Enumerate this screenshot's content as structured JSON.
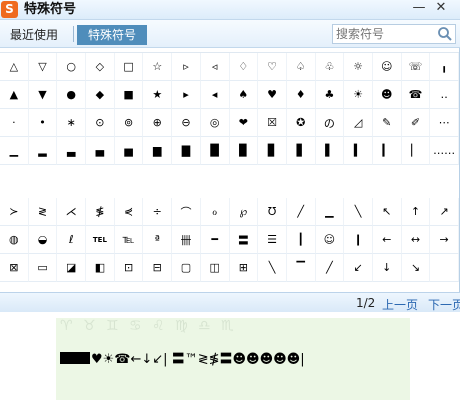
{
  "window": {
    "title": "特殊符号",
    "logo": "S",
    "minimize": "—",
    "close": "✕"
  },
  "tabs": {
    "recent": "最近使用",
    "special": "特殊符号"
  },
  "search": {
    "placeholder": "搜索符号"
  },
  "symbols_top": [
    [
      "△",
      "▽",
      "○",
      "◇",
      "□",
      "☆",
      "▹",
      "◃",
      "♢",
      "♡",
      "♤",
      "♧",
      "☼",
      "☺",
      "☏",
      "╻"
    ],
    [
      "▲",
      "▼",
      "●",
      "◆",
      "■",
      "★",
      "▸",
      "◂",
      "♠",
      "♥",
      "♦",
      "♣",
      "☀",
      "☻",
      "☎",
      "‥"
    ],
    [
      "·",
      "•",
      "∗",
      "⊙",
      "⊚",
      "⊕",
      "⊖",
      "◎",
      "❤",
      "☒",
      "✪",
      "の",
      "◿",
      "✎",
      "✐",
      "⋯"
    ],
    [
      "▁",
      "▂",
      "▃",
      "▄",
      "▅",
      "▆",
      "▇",
      "█",
      "▉",
      "▊",
      "▋",
      "▌",
      "▍",
      "▎",
      "▏",
      "……"
    ]
  ],
  "symbols_bottom": [
    [
      "≻",
      "≷",
      "⋌",
      "≸",
      "⋞",
      "÷",
      "⌒",
      "ℴ",
      "℘",
      "℧",
      "╱",
      "▁",
      "╲",
      "↖",
      "↑",
      "↗"
    ],
    [
      "◍",
      "◒",
      "ℓ",
      "TEL",
      "℡",
      "ª",
      "卌",
      "━",
      "〓",
      "☰",
      "┃",
      "☺",
      "❙",
      "←",
      "↔",
      "→"
    ],
    [
      "⊠",
      "▭",
      "◪",
      "◧",
      "⊡",
      "⊟",
      "▢",
      "◫",
      "⊞",
      "╲",
      "▔",
      "╱",
      "↙",
      "↓",
      "↘",
      ""
    ]
  ],
  "pager": {
    "page": "1/2",
    "prev": "上一页",
    "next": "下一页"
  },
  "document": {
    "ghost_text": "♈ ♉ ♊ ♋ ♌ ♍ ♎ ♏",
    "typed_text": "♥☀☎←↓↙| 〓™≷≸〓☻☻☻☻☻|"
  }
}
